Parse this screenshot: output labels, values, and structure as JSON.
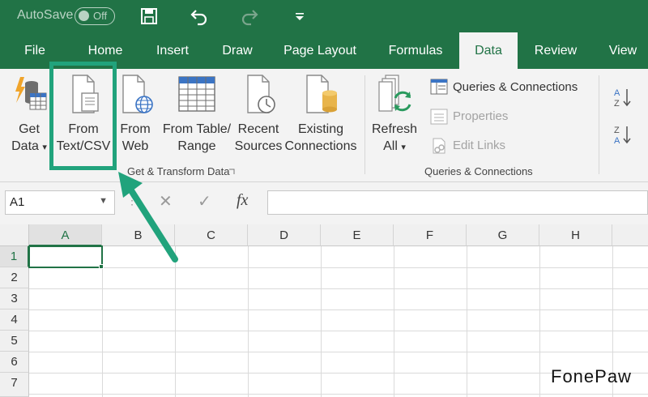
{
  "titlebar": {
    "autosave_label": "AutoSave",
    "toggle_state": "Off"
  },
  "tabs": [
    {
      "label": "File"
    },
    {
      "label": "Home"
    },
    {
      "label": "Insert"
    },
    {
      "label": "Draw"
    },
    {
      "label": "Page Layout"
    },
    {
      "label": "Formulas"
    },
    {
      "label": "Data"
    },
    {
      "label": "Review"
    },
    {
      "label": "View"
    }
  ],
  "ribbon": {
    "get_data": {
      "line1": "Get",
      "line2": "Data"
    },
    "from_text": {
      "line1": "From",
      "line2": "Text/CSV"
    },
    "from_web": {
      "line1": "From",
      "line2": "Web"
    },
    "from_table": {
      "line1": "From Table/",
      "line2": "Range"
    },
    "recent_sources": {
      "line1": "Recent",
      "line2": "Sources"
    },
    "existing_connections": {
      "line1": "Existing",
      "line2": "Connections"
    },
    "refresh_all": {
      "line1": "Refresh",
      "line2": "All"
    },
    "queries_connections": "Queries & Connections",
    "properties": "Properties",
    "edit_links": "Edit Links",
    "group_get_transform": "Get & Transform Data",
    "group_queries": "Queries & Connections"
  },
  "formula_bar": {
    "name_box": "A1",
    "fx": "fx"
  },
  "grid": {
    "columns": [
      "A",
      "B",
      "C",
      "D",
      "E",
      "F",
      "G",
      "H"
    ],
    "rows": [
      "1",
      "2",
      "3",
      "4",
      "5",
      "6",
      "7"
    ]
  },
  "watermark": "FonePaw",
  "colors": {
    "accent": "#217346",
    "highlight": "#21a37c"
  }
}
